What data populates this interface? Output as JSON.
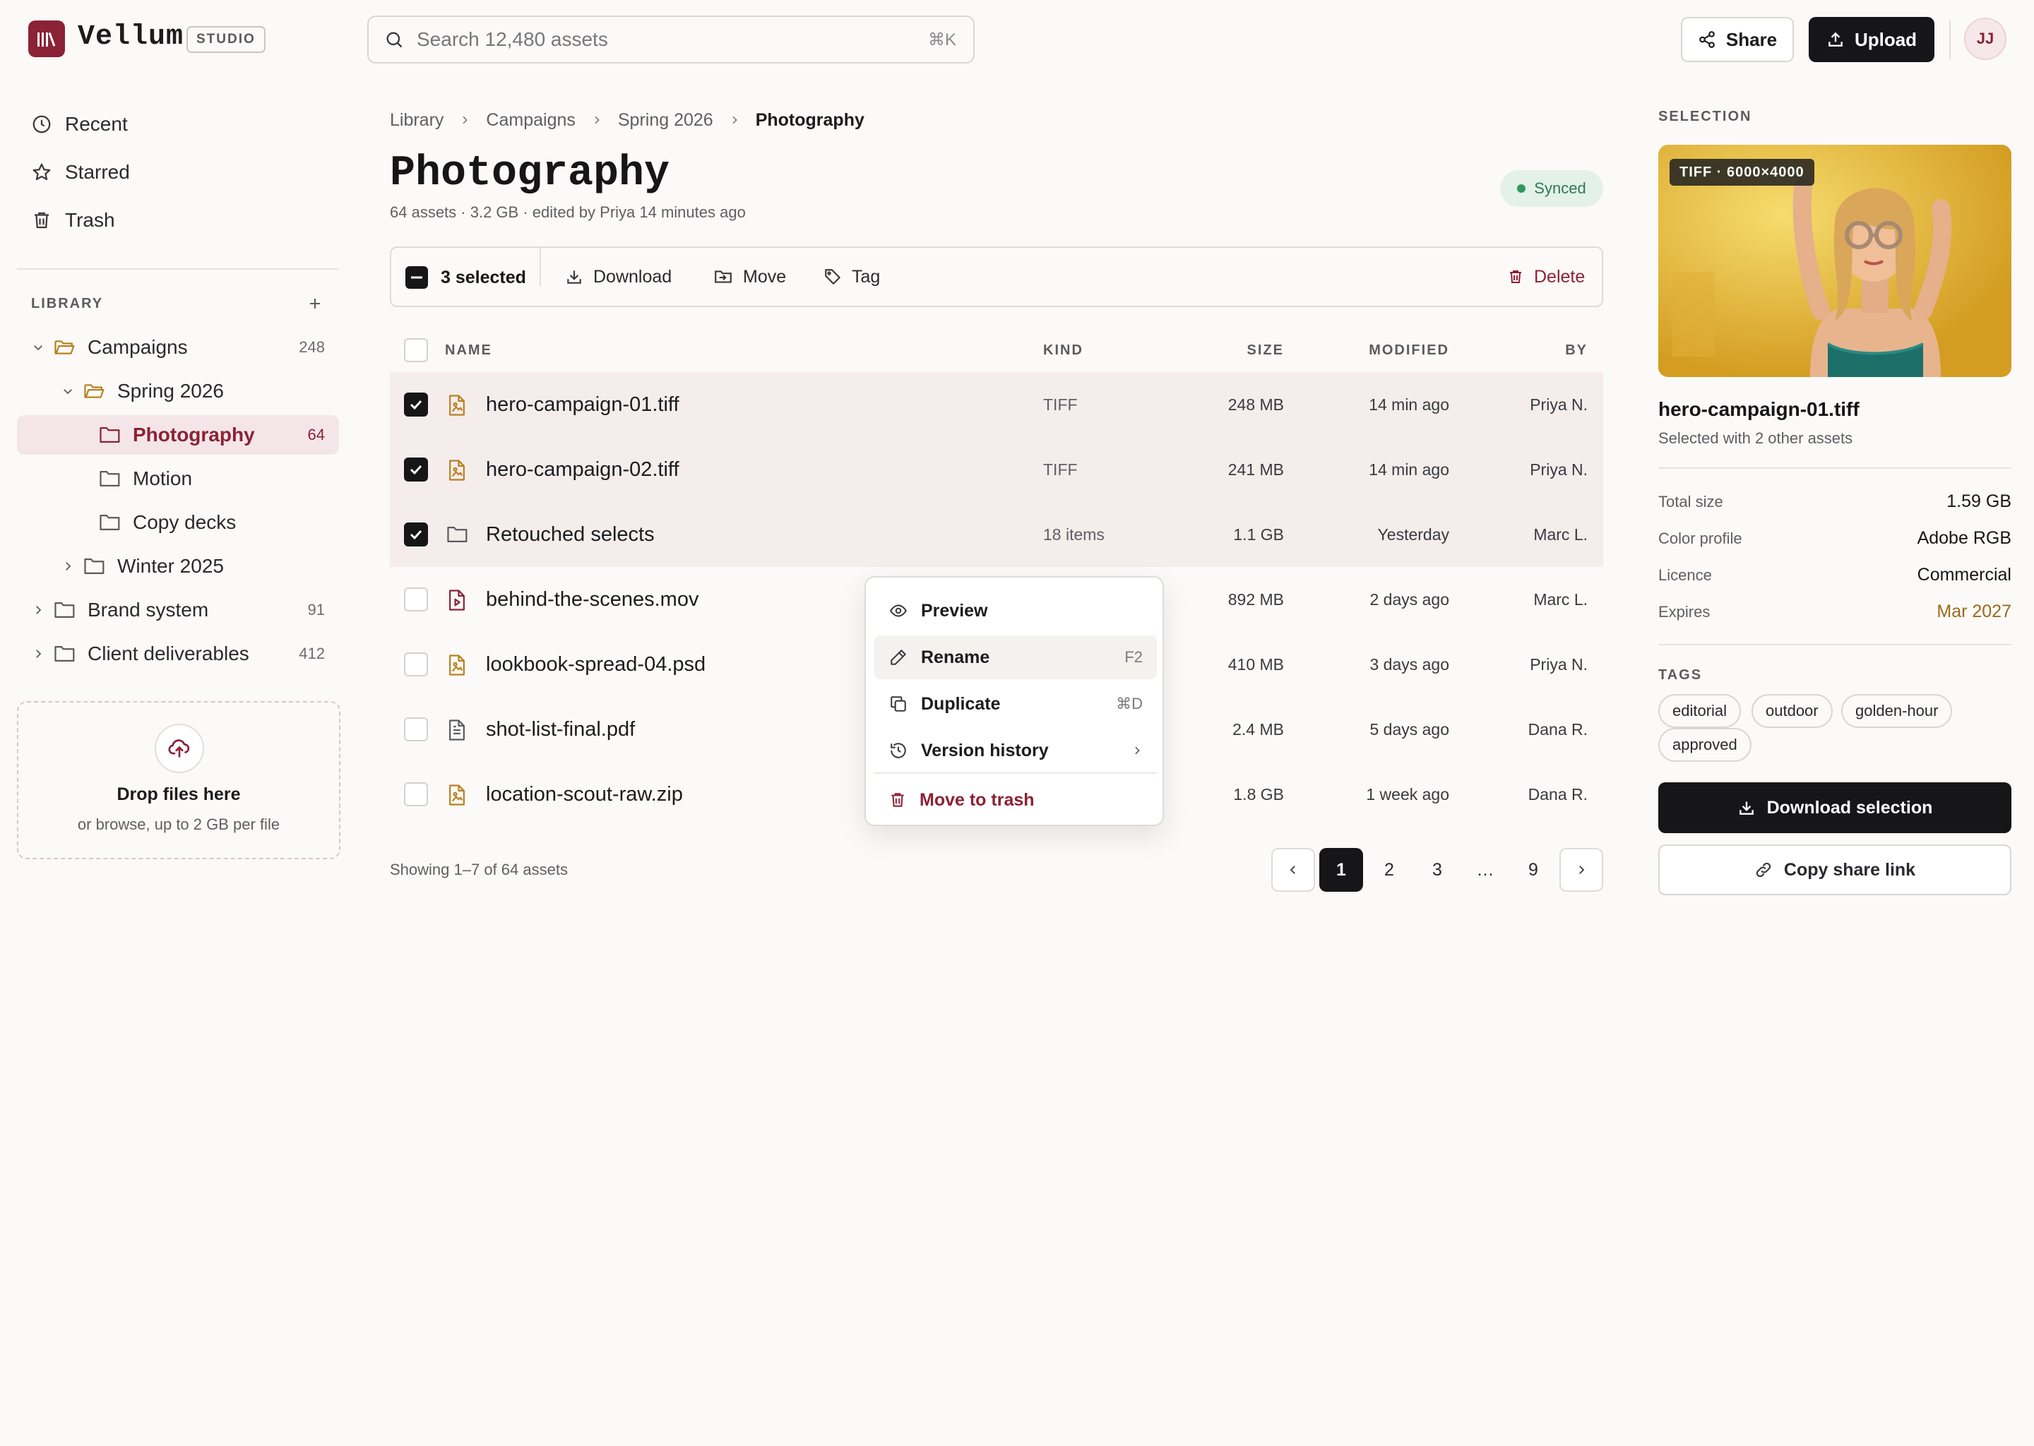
{
  "app": {
    "name": "Vellum",
    "badge": "STUDIO",
    "search_placeholder": "Search 12,480 assets",
    "search_shortcut": "⌘K",
    "share_label": "Share",
    "upload_label": "Upload",
    "avatar_initials": "JJ",
    "brand_color": "#8b2235"
  },
  "sidebar": {
    "nav": [
      {
        "label": "Recent",
        "icon": "clock-icon"
      },
      {
        "label": "Starred",
        "icon": "star-icon"
      },
      {
        "label": "Trash",
        "icon": "trash-icon"
      }
    ],
    "library_header": "LIBRARY",
    "tree": [
      {
        "label": "Campaigns",
        "count": "248",
        "expanded": true
      },
      {
        "label": "Spring 2026",
        "count": "",
        "expanded": true
      },
      {
        "label": "Photography",
        "count": "64",
        "active": true
      },
      {
        "label": "Motion",
        "count": ""
      },
      {
        "label": "Copy decks",
        "count": ""
      },
      {
        "label": "Winter 2025",
        "count": "",
        "expanded": false
      },
      {
        "label": "Brand system",
        "count": "91",
        "expanded": false
      },
      {
        "label": "Client deliverables",
        "count": "412",
        "expanded": false
      }
    ],
    "dropzone": {
      "title": "Drop files here",
      "subtitle": "or browse, up to 2 GB per file"
    }
  },
  "main": {
    "breadcrumb": [
      "Library",
      "Campaigns",
      "Spring 2026",
      "Photography"
    ],
    "title": "Photography",
    "meta": "64 assets · 3.2 GB · edited by Priya 14 minutes ago",
    "status": "Synced",
    "actionbar": {
      "selected": "3 selected",
      "download": "Download",
      "move": "Move",
      "tag": "Tag",
      "delete": "Delete"
    },
    "columns": {
      "name": "NAME",
      "kind": "KIND",
      "size": "SIZE",
      "modified": "MODIFIED",
      "by": "BY"
    },
    "rows": [
      {
        "name": "hero-campaign-01.tiff",
        "kind": "TIFF",
        "size": "248 MB",
        "modified": "14 min ago",
        "by": "Priya N.",
        "selected": true,
        "icon": "image-file-icon"
      },
      {
        "name": "hero-campaign-02.tiff",
        "kind": "TIFF",
        "size": "241 MB",
        "modified": "14 min ago",
        "by": "Priya N.",
        "selected": true,
        "icon": "image-file-icon"
      },
      {
        "name": "Retouched selects",
        "kind": "18 items",
        "size": "1.1 GB",
        "modified": "Yesterday",
        "by": "Marc L.",
        "selected": true,
        "icon": "folder-icon"
      },
      {
        "name": "behind-the-scenes.mov",
        "kind": "",
        "size": "892 MB",
        "modified": "2 days ago",
        "by": "Marc L.",
        "selected": false,
        "icon": "video-file-icon"
      },
      {
        "name": "lookbook-spread-04.psd",
        "kind": "",
        "size": "410 MB",
        "modified": "3 days ago",
        "by": "Priya N.",
        "selected": false,
        "icon": "image-file-icon"
      },
      {
        "name": "shot-list-final.pdf",
        "kind": "",
        "size": "2.4 MB",
        "modified": "5 days ago",
        "by": "Dana R.",
        "selected": false,
        "icon": "document-file-icon"
      },
      {
        "name": "location-scout-raw.zip",
        "kind": "",
        "size": "1.8 GB",
        "modified": "1 week ago",
        "by": "Dana R.",
        "selected": false,
        "icon": "image-file-icon"
      }
    ],
    "context_menu": [
      {
        "label": "Preview",
        "shortcut": "",
        "icon": "eye-icon"
      },
      {
        "label": "Rename",
        "shortcut": "F2",
        "icon": "pencil-icon"
      },
      {
        "label": "Duplicate",
        "shortcut": "⌘D",
        "icon": "duplicate-icon"
      },
      {
        "label": "Version history",
        "shortcut": "",
        "icon": "history-icon"
      },
      {
        "label": "Move to trash",
        "shortcut": "",
        "icon": "trash-icon"
      }
    ],
    "showing": "Showing 1–7 of 64 assets",
    "pages": [
      "1",
      "2",
      "3",
      "…",
      "9"
    ],
    "current_page": "1"
  },
  "panel": {
    "label": "SELECTION",
    "preview_badge": "TIFF · 6000×4000",
    "file_name": "hero-campaign-01.tiff",
    "subtitle": "Selected with 2 other assets",
    "properties": [
      {
        "key": "Total size",
        "value": "1.59 GB"
      },
      {
        "key": "Color profile",
        "value": "Adobe RGB"
      },
      {
        "key": "Licence",
        "value": "Commercial"
      },
      {
        "key": "Expires",
        "value": "Mar 2027"
      }
    ],
    "tags_label": "TAGS",
    "tags": [
      "editorial",
      "outdoor",
      "golden-hour",
      "approved"
    ],
    "download_label": "Download selection",
    "copy_label": "Copy share link"
  }
}
